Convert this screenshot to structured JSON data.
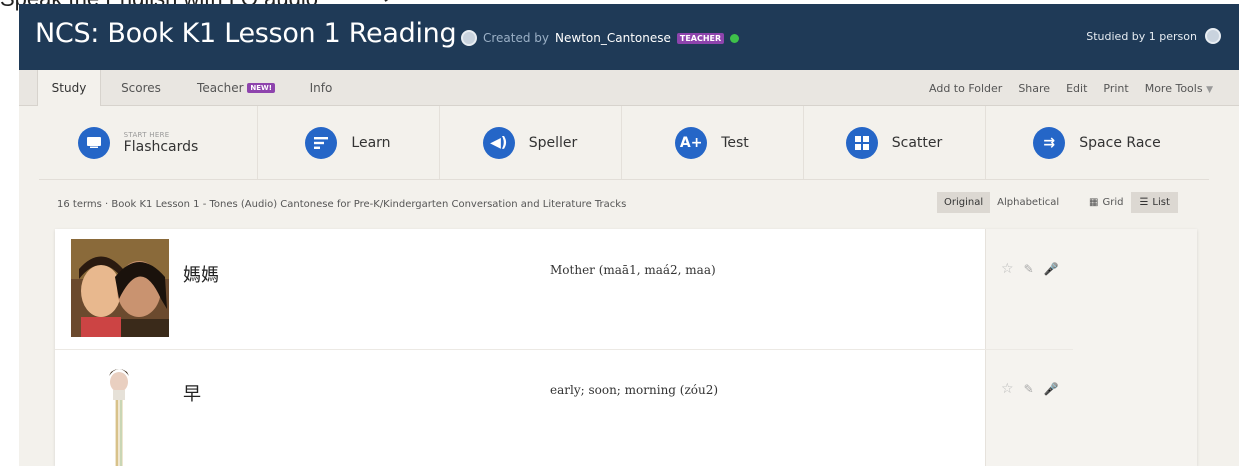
{
  "annotation": {
    "text": "Speak the English with LO audio",
    "color": "#222222"
  },
  "header": {
    "title": "NCS: Book K1 Lesson 1 Reading",
    "created_by_prefix": "Created by",
    "creator": "Newton_Cantonese",
    "teacher_badge": "TEACHER",
    "studied_by": "Studied by 1 person",
    "bg_color": "#1f3a57"
  },
  "nav": {
    "tabs": [
      {
        "label": "Study",
        "active": true
      },
      {
        "label": "Scores",
        "active": false
      },
      {
        "label": "Teacher",
        "badge": "NEW!",
        "active": false
      },
      {
        "label": "Info",
        "active": false
      }
    ],
    "right": [
      "Add to Folder",
      "Share",
      "Edit",
      "Print",
      "More Tools"
    ]
  },
  "modes": [
    {
      "label": "Flashcards",
      "sublabel": "START HERE",
      "icon": "flashcards-icon"
    },
    {
      "label": "Learn",
      "icon": "learn-icon"
    },
    {
      "label": "Speller",
      "icon": "speaker-icon"
    },
    {
      "label": "Test",
      "icon": "test-icon"
    },
    {
      "label": "Scatter",
      "icon": "scatter-icon"
    },
    {
      "label": "Space Race",
      "icon": "space-race-icon"
    }
  ],
  "terms_info": "16 terms · Book K1 Lesson 1 - Tones (Audio) Cantonese for Pre-K/Kindergarten Conversation and Literature Tracks",
  "sort": {
    "original": "Original",
    "alphabetical": "Alphabetical"
  },
  "view": {
    "grid": "Grid",
    "list": "List"
  },
  "terms": [
    {
      "word": "媽媽",
      "definition": "Mother (maā1, maá2, maa)"
    },
    {
      "word": "早",
      "definition": "early; soon; morning (zóu2)"
    }
  ],
  "accent_color": "#2566c7"
}
